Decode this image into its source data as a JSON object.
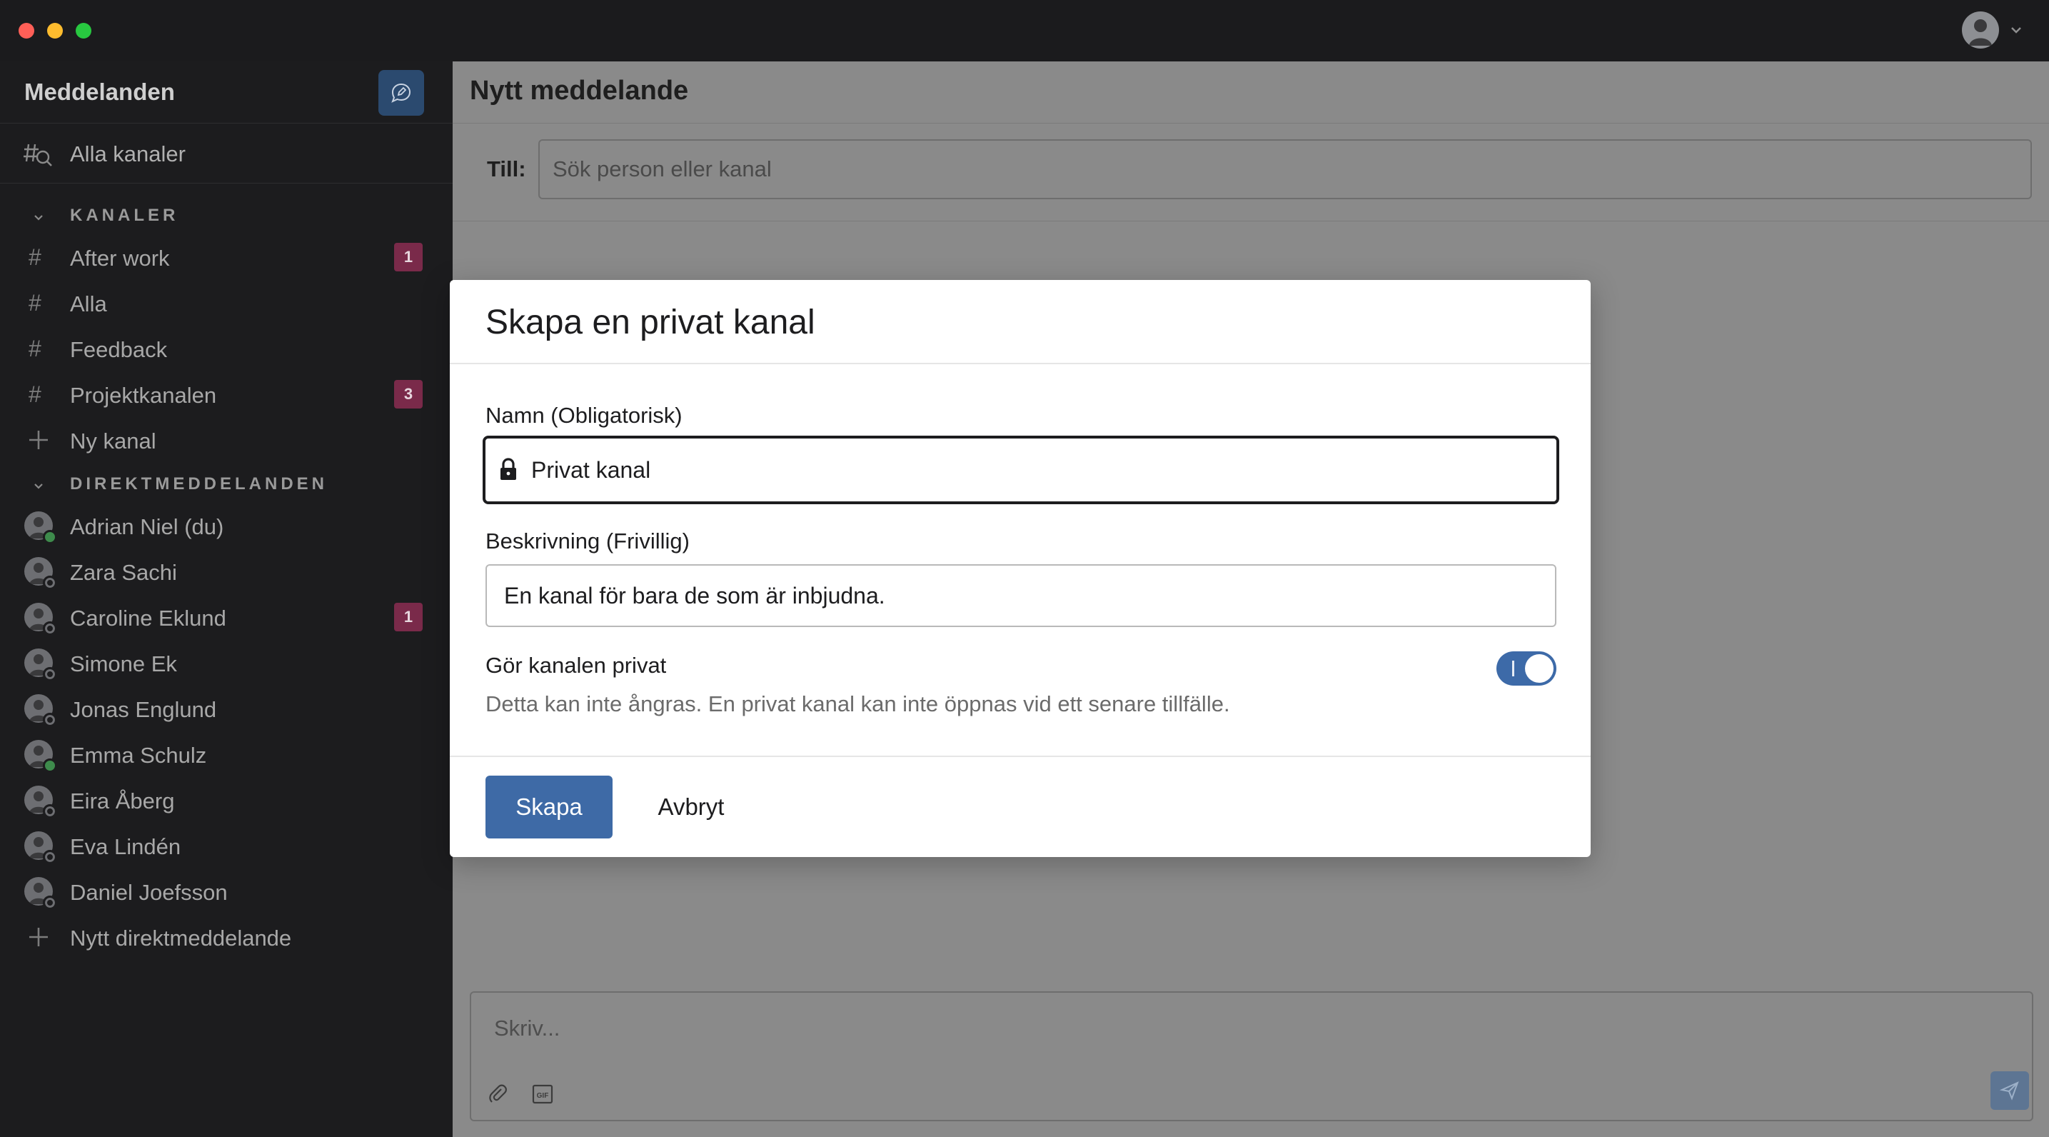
{
  "sidebar": {
    "title": "Meddelanden",
    "all_channels": "Alla kanaler",
    "channels_heading": "KANALER",
    "channels": [
      {
        "label": "After work",
        "badge": "1"
      },
      {
        "label": "Alla",
        "badge": ""
      },
      {
        "label": "Feedback",
        "badge": ""
      },
      {
        "label": "Projektkanalen",
        "badge": "3"
      }
    ],
    "new_channel": "Ny kanal",
    "dm_heading": "DIREKTMEDDELANDEN",
    "dms": [
      {
        "label": "Adrian Niel (du)",
        "badge": "",
        "status": "online"
      },
      {
        "label": "Zara Sachi",
        "badge": "",
        "status": "away"
      },
      {
        "label": "Caroline Eklund",
        "badge": "1",
        "status": "away"
      },
      {
        "label": "Simone Ek",
        "badge": "",
        "status": "away"
      },
      {
        "label": "Jonas Englund",
        "badge": "",
        "status": "away"
      },
      {
        "label": "Emma Schulz",
        "badge": "",
        "status": "online"
      },
      {
        "label": "Eira Åberg",
        "badge": "",
        "status": "away"
      },
      {
        "label": "Eva Lindén",
        "badge": "",
        "status": "away"
      },
      {
        "label": "Daniel Joefsson",
        "badge": "",
        "status": "away"
      }
    ],
    "new_dm": "Nytt direktmeddelande"
  },
  "main": {
    "title": "Nytt meddelande",
    "to_label": "Till:",
    "to_placeholder": "Sök person eller kanal",
    "composer_placeholder": "Skriv..."
  },
  "modal": {
    "title": "Skapa en privat kanal",
    "name_label": "Namn (Obligatorisk)",
    "name_value": "Privat kanal",
    "desc_label": "Beskrivning (Frivillig)",
    "desc_value": "En kanal för bara de som är inbjudna.",
    "private_label": "Gör kanalen privat",
    "private_help": "Detta kan inte ångras. En privat kanal kan inte öppnas vid ett senare tillfälle.",
    "private_enabled": true,
    "create_button": "Skapa",
    "cancel_button": "Avbryt"
  },
  "colors": {
    "accent": "#3e6aa6",
    "badge": "#7a2a4a",
    "online": "#3e8b4c"
  }
}
